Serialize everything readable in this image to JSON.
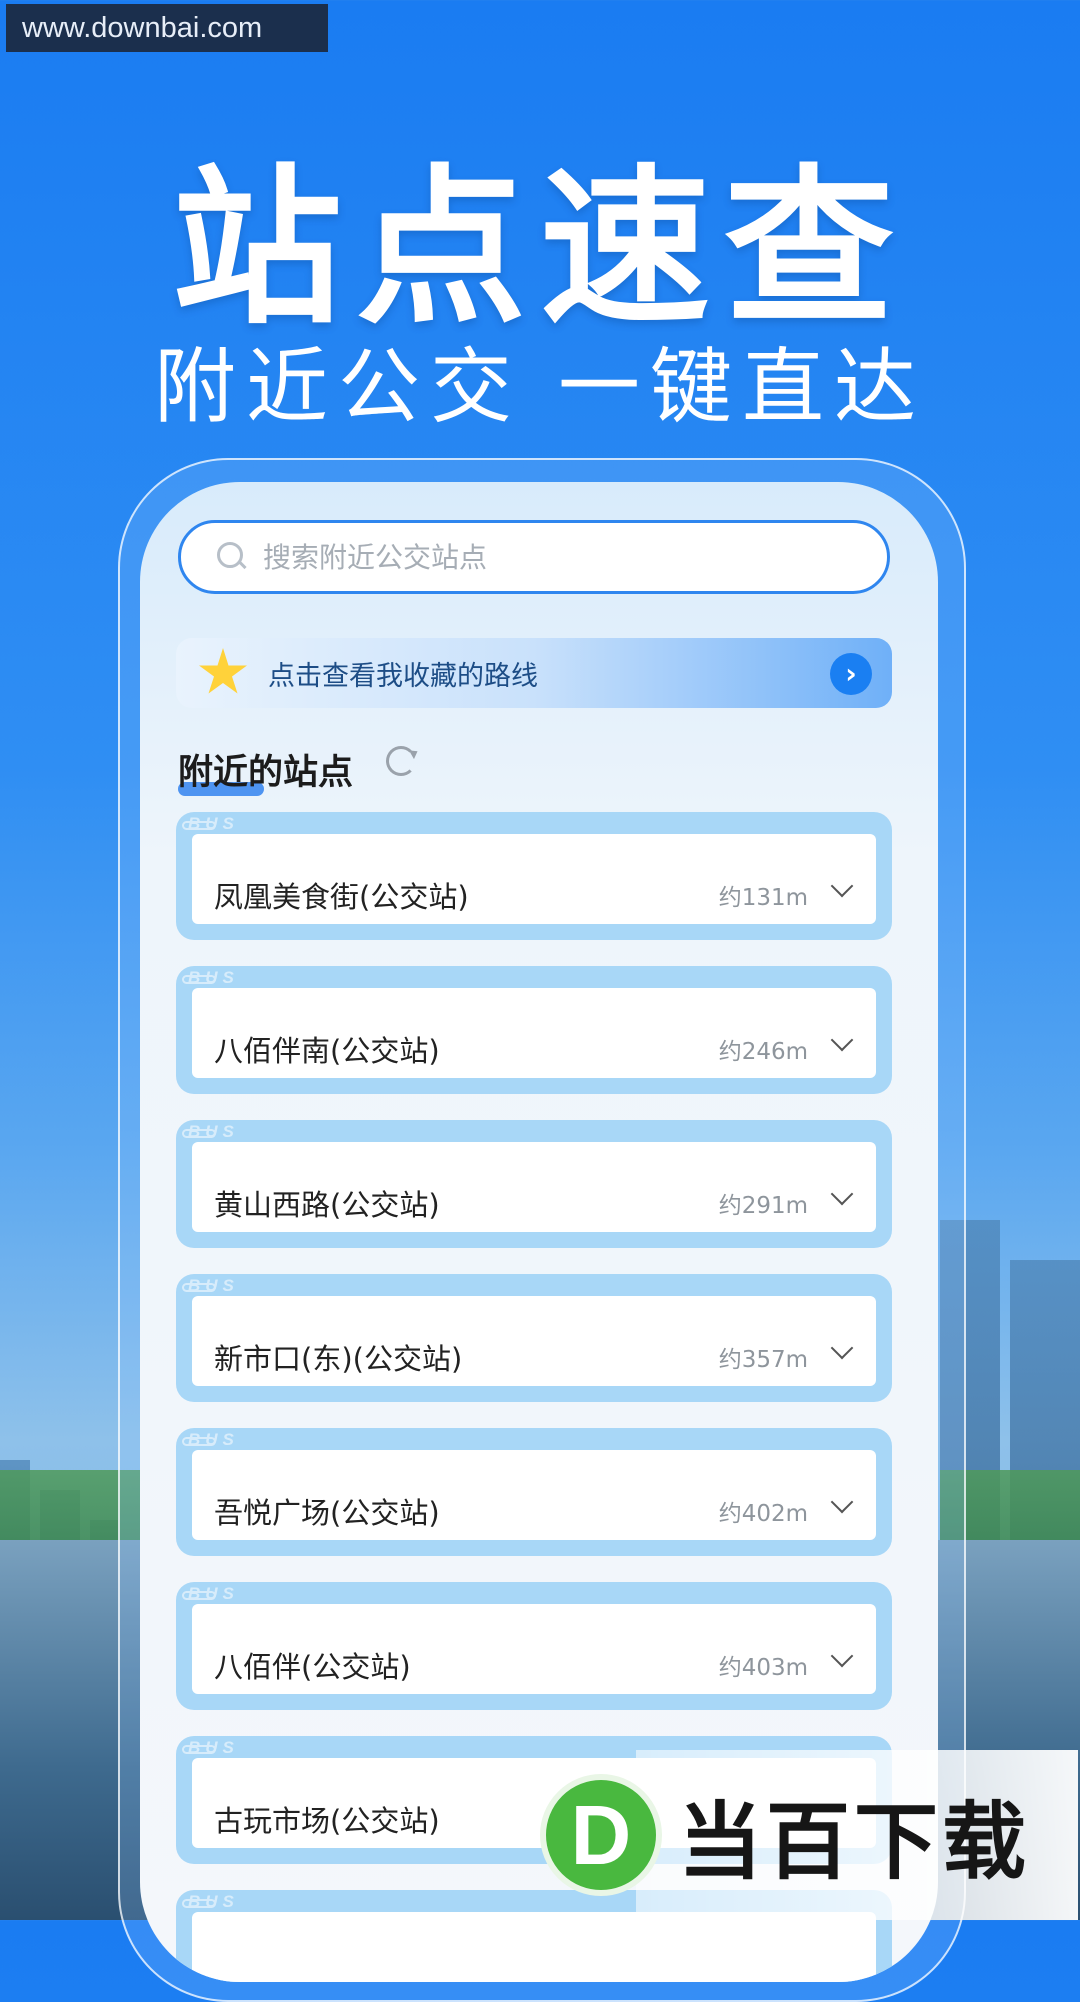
{
  "watermark_top": "www.downbai.com",
  "headline": "站点速查",
  "subline": "附近公交 一键直达",
  "search": {
    "placeholder": "搜索附近公交站点"
  },
  "favorites_banner": {
    "label": "点击查看我收藏的路线"
  },
  "section_title": "附近的站点",
  "bus_tag": "BUS",
  "stations": [
    {
      "name": "凤凰美食街(公交站)",
      "distance": "约131m"
    },
    {
      "name": "八佰伴南(公交站)",
      "distance": "约246m"
    },
    {
      "name": "黄山西路(公交站)",
      "distance": "约291m"
    },
    {
      "name": "新市口(东)(公交站)",
      "distance": "约357m"
    },
    {
      "name": "吾悦广场(公交站)",
      "distance": "约402m"
    },
    {
      "name": "八佰伴(公交站)",
      "distance": "约403m"
    },
    {
      "name": "古玩市场(公交站)",
      "distance": ""
    }
  ],
  "watermark_logo": {
    "letter": "D",
    "text": "当百下载"
  },
  "colors": {
    "accent": "#1a7ff2",
    "card_frame": "#a8d7f7"
  }
}
